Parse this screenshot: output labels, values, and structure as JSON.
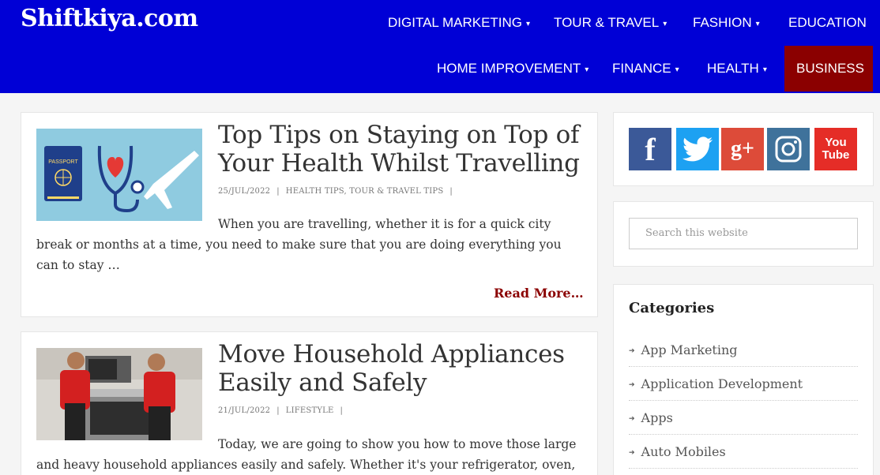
{
  "site": {
    "logo": "Shiftkiya.com"
  },
  "nav": {
    "items": [
      {
        "label": "DIGITAL MARKETING",
        "caret": "▾"
      },
      {
        "label": "TOUR & TRAVEL",
        "caret": "▾"
      },
      {
        "label": "FASHION",
        "caret": "▾"
      },
      {
        "label": "EDUCATION",
        "caret": ""
      },
      {
        "label": "HOME IMPROVEMENT",
        "caret": "▾"
      },
      {
        "label": "FINANCE",
        "caret": "▾"
      },
      {
        "label": "HEALTH",
        "caret": "▾"
      },
      {
        "label": "BUSINESS",
        "caret": ""
      }
    ],
    "active": "BUSINESS",
    "colors": {
      "bar": "#0000d6",
      "active": "#8b0000"
    }
  },
  "posts": [
    {
      "title": "Top Tips on Staying on Top of Your Health Whilst Travelling",
      "date": "25/JUL/2022",
      "categories": "HEALTH TIPS, TOUR & TRAVEL TIPS",
      "excerpt": "When you are travelling, whether it is for a quick city break or months at a time, you need to make sure that you are doing everything you can to stay …",
      "read_more": "Read More…",
      "thumb_icon": "passport-stethoscope-plane-image",
      "passport_text": "PASSPORT"
    },
    {
      "title": "Move Household Appliances Easily and Safely",
      "date": "21/JUL/2022",
      "categories": "LIFESTYLE",
      "excerpt": "Today, we are going to show you how to move those large and heavy household appliances easily and safely. Whether it's your refrigerator, oven,",
      "thumb_icon": "movers-appliance-image"
    }
  ],
  "sidebar": {
    "social": [
      {
        "name": "facebook",
        "glyph": "f",
        "color": "#3b5998"
      },
      {
        "name": "twitter",
        "glyph": "🐦",
        "color": "#1da1f2"
      },
      {
        "name": "google-plus",
        "glyph": "g+",
        "color": "#dd4b39"
      },
      {
        "name": "instagram",
        "glyph": "◎",
        "color": "#3f729b"
      },
      {
        "name": "youtube",
        "glyph": "You Tube",
        "color": "#e52d27"
      }
    ],
    "search_placeholder": "Search this website",
    "categories_title": "Categories",
    "categories": [
      "App Marketing",
      "Application Development",
      "Apps",
      "Auto Mobiles"
    ]
  }
}
